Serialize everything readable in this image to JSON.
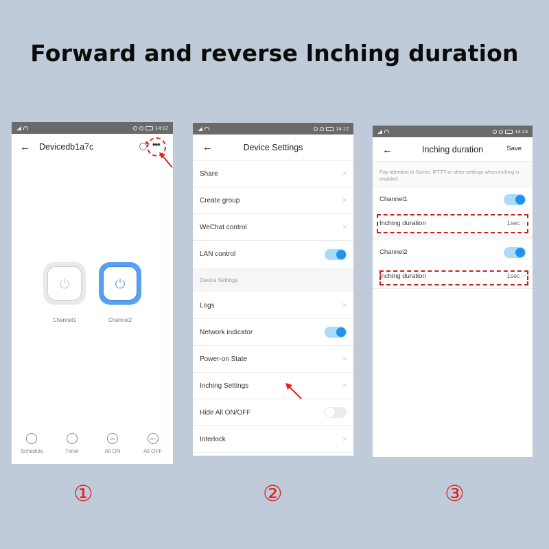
{
  "headline": "Forward and reverse lnching duration",
  "steps": [
    "①",
    "②",
    "③"
  ],
  "accent_color": "#1e94f0",
  "highlight_color": "#e02424",
  "screen1": {
    "status": {
      "time": "14:12"
    },
    "title": "Devicedb1a7c",
    "more_icon": "•••",
    "channels": [
      {
        "label": "Channel1",
        "state": "off"
      },
      {
        "label": "Channel2",
        "state": "on"
      }
    ],
    "bottom_bar": [
      {
        "label": "Schedule",
        "icon": "alarm-clock-icon",
        "glyph": ""
      },
      {
        "label": "Timer",
        "icon": "stopwatch-icon",
        "glyph": ""
      },
      {
        "label": "All ON",
        "icon": "all-on-icon",
        "glyph": "ON"
      },
      {
        "label": "All OFF",
        "icon": "all-off-icon",
        "glyph": "OFF"
      }
    ]
  },
  "screen2": {
    "status": {
      "time": "14:12"
    },
    "title": "Device Settings",
    "rows_top": [
      {
        "label": "Share",
        "type": "link"
      },
      {
        "label": "Create group",
        "type": "link"
      },
      {
        "label": "WeChat control",
        "type": "link"
      },
      {
        "label": "LAN control",
        "type": "toggle",
        "on": true
      }
    ],
    "section_label": "Device Settings",
    "rows_bottom": [
      {
        "label": "Logs",
        "type": "link"
      },
      {
        "label": "Network indicator",
        "type": "toggle",
        "on": true
      },
      {
        "label": "Power-on State",
        "type": "link"
      },
      {
        "label": "Inching Settings",
        "type": "link"
      },
      {
        "label": "Hide All ON/OFF",
        "type": "toggle",
        "on": false
      },
      {
        "label": "Interlock",
        "type": "link"
      }
    ]
  },
  "screen3": {
    "status": {
      "time": "14:13"
    },
    "title": "Inching duration",
    "save_label": "Save",
    "note": "Pay attention to Scene, IFTTT or other settings when inching is enabled.",
    "channels": [
      {
        "label": "Channel1",
        "enabled": true,
        "duration_label": "Inching duration",
        "duration_value": "1sec"
      },
      {
        "label": "Channel2",
        "enabled": true,
        "duration_label": "Inching duration",
        "duration_value": "1sec"
      }
    ]
  }
}
